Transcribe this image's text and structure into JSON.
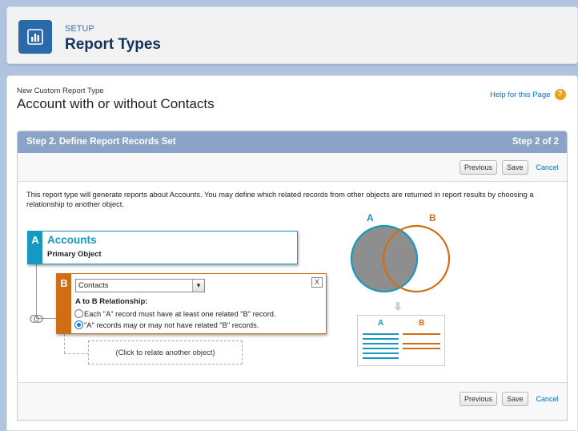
{
  "header": {
    "section": "SETUP",
    "title": "Report Types",
    "icon": "report-chart-icon"
  },
  "page": {
    "subtitle": "New Custom Report Type",
    "title": "Account with or without Contacts",
    "help_link": "Help for this Page",
    "help_icon": "question-icon"
  },
  "step": {
    "title": "Step 2. Define Report Records Set",
    "count": "Step 2 of 2"
  },
  "buttons": {
    "previous": "Previous",
    "save": "Save",
    "cancel": "Cancel"
  },
  "description": "This report type will generate reports about Accounts. You may define which related records from other objects are returned in report results by choosing a relationship to another object.",
  "object_a": {
    "letter": "A",
    "name": "Accounts",
    "role": "Primary Object"
  },
  "object_b": {
    "letter": "B",
    "selected": "Contacts",
    "close": "X",
    "relationship_label": "A to B Relationship:",
    "options": [
      {
        "label": "Each \"A\" record must have at least one related \"B\" record.",
        "checked": false
      },
      {
        "label": "\"A\" records may or may not have related \"B\" records.",
        "checked": true
      }
    ]
  },
  "relate_another": "(Click to relate another object)",
  "venn": {
    "label_a": "A",
    "label_b": "B",
    "color_a": "#1798c1",
    "color_b": "#d06d15"
  },
  "legend": {
    "label_a": "A",
    "label_b": "B"
  },
  "colors": {
    "accent_blue": "#1798c1",
    "accent_orange": "#d06d15",
    "step_bar": "#8aa3c6",
    "page_background": "#b0c4df"
  }
}
